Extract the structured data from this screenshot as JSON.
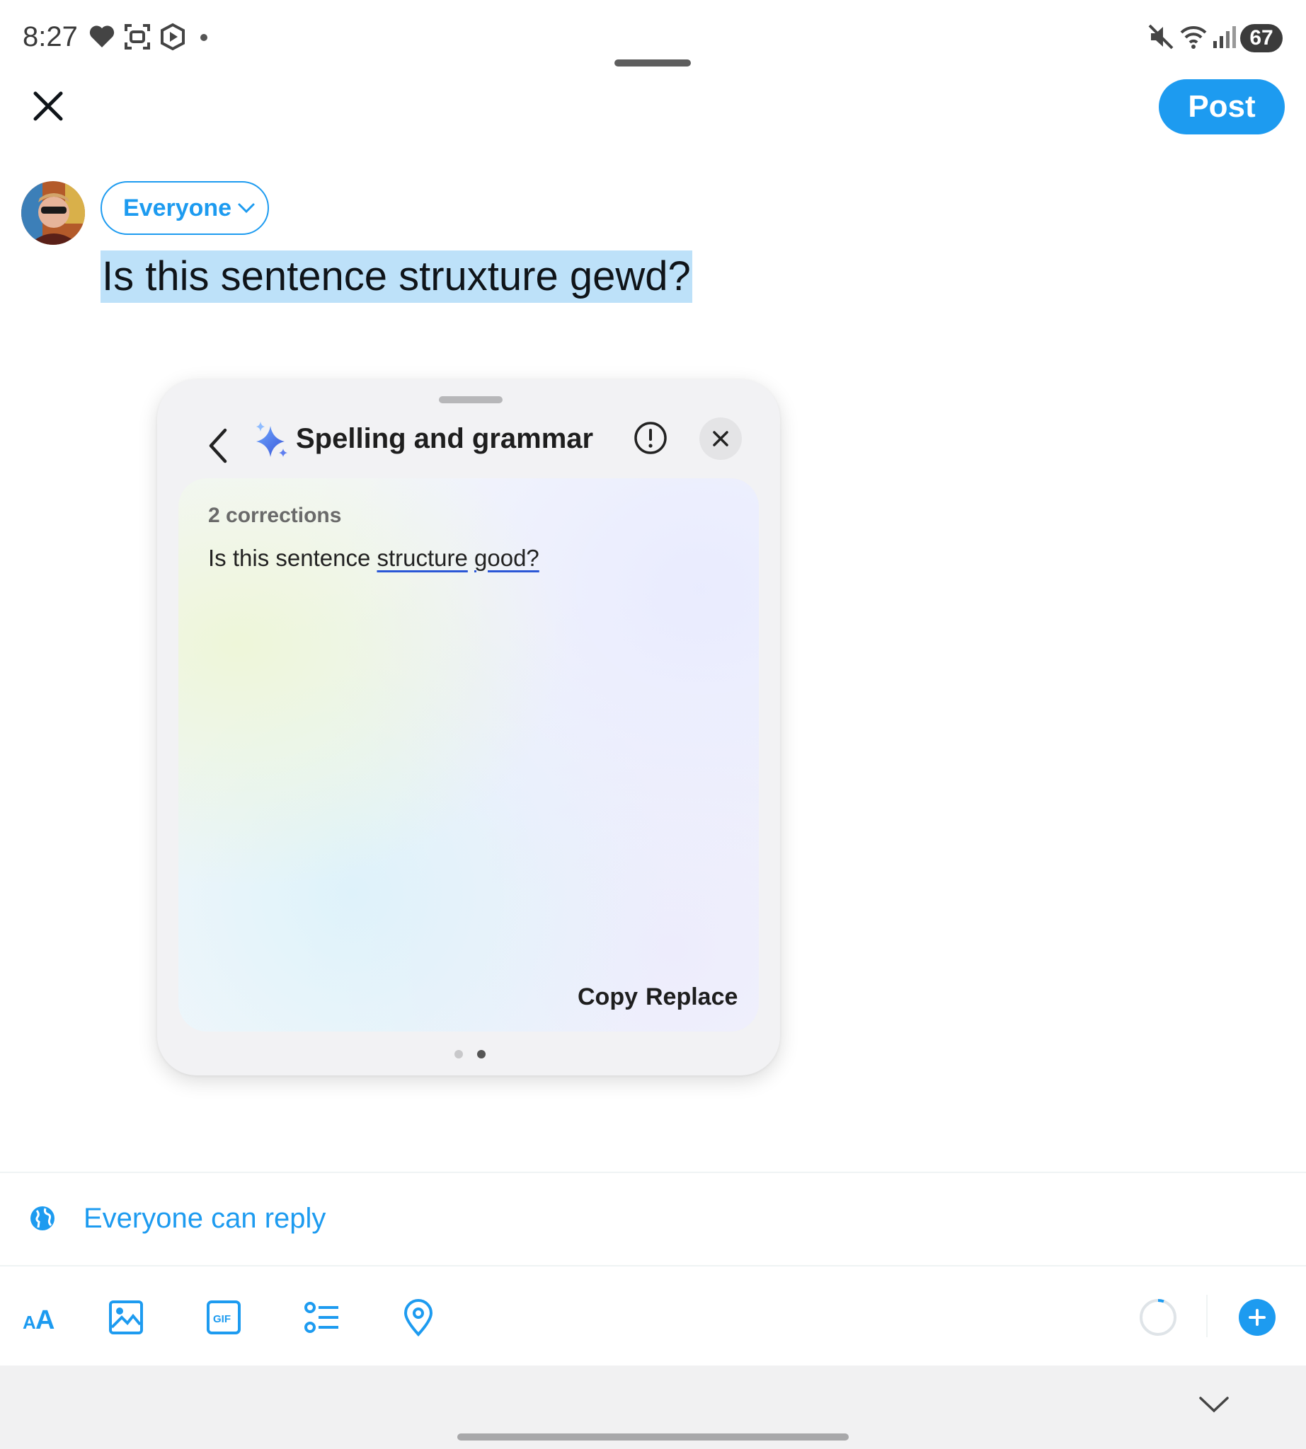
{
  "status_bar": {
    "time": "8:27",
    "battery": "67",
    "icons": [
      "heart-icon",
      "screenshot-icon",
      "shield-play-icon",
      "dot-icon",
      "mute-icon",
      "wifi-icon",
      "signal-icon",
      "battery-icon"
    ]
  },
  "compose": {
    "post_label": "Post",
    "audience_label": "Everyone",
    "text": "Is this sentence struxture gewd?"
  },
  "popup": {
    "title": "Spelling and grammar",
    "corrections_count": "2 corrections",
    "corrected_prefix": "Is this sentence ",
    "corrected_word_1": "structure",
    "corrected_space": " ",
    "corrected_word_2": "good?",
    "copy_label": "Copy",
    "replace_label": "Replace",
    "page_index": 2,
    "page_count": 2
  },
  "reply": {
    "label": "Everyone can reply"
  },
  "toolbar": {
    "items": [
      "text-format-icon",
      "image-icon",
      "gif-icon",
      "poll-icon",
      "location-icon"
    ]
  },
  "colors": {
    "accent": "#1d9bf0",
    "selection": "#bde1f9",
    "correction_underline": "#2a56d6"
  }
}
